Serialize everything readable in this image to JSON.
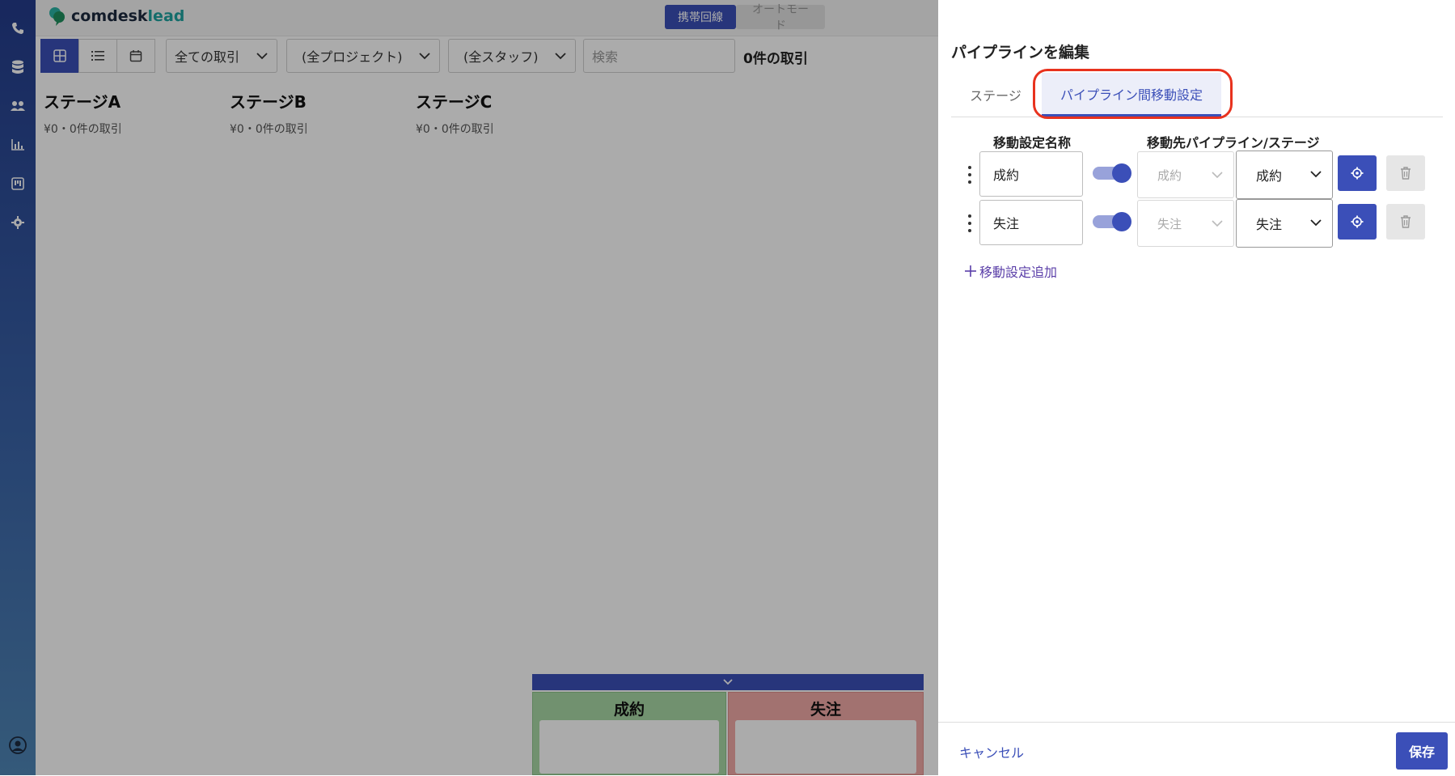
{
  "app": {
    "logo_text_primary": "comdesk",
    "logo_text_secondary": "lead"
  },
  "header": {
    "mobile_line_label": "携帯回線",
    "auto_mode_label": "オートモード"
  },
  "sidebar": {
    "icons": [
      "phone-icon",
      "database-icon",
      "users-icon",
      "chart-icon",
      "board-icon",
      "gear-icon",
      "account-icon"
    ]
  },
  "toolbar": {
    "view_buttons": [
      "board-view-icon",
      "list-view-icon",
      "calendar-view-icon"
    ],
    "deal_filter": "全ての取引",
    "project_filter": "(全プロジェクト)",
    "staff_filter": "(全スタッフ)",
    "search_placeholder": "検索",
    "deal_count": "0件の取引"
  },
  "stages": [
    {
      "name": "ステージA",
      "meta": "¥0・0件の取引"
    },
    {
      "name": "ステージB",
      "meta": "¥0・0件の取引"
    },
    {
      "name": "ステージC",
      "meta": "¥0・0件の取引"
    }
  ],
  "drop_zones": {
    "won_label": "成約",
    "lost_label": "失注"
  },
  "panel": {
    "title": "パイプラインを編集",
    "tabs": {
      "stage": "ステージ",
      "move": "パイプライン間移動設定"
    },
    "columns": {
      "name": "移動設定名称",
      "destination": "移動先パイプライン/ステージ"
    },
    "rows": [
      {
        "name": "成約",
        "enabled": true,
        "pipeline": "成約",
        "stage": "成約"
      },
      {
        "name": "失注",
        "enabled": true,
        "pipeline": "失注",
        "stage": "失注"
      }
    ],
    "add_label": "移動設定追加",
    "cancel_label": "キャンセル",
    "save_label": "保存"
  },
  "colors": {
    "accent": "#3b4fb8",
    "highlight": "#e8321e",
    "won": "#a9d9a6",
    "lost": "#f2aaa8"
  }
}
